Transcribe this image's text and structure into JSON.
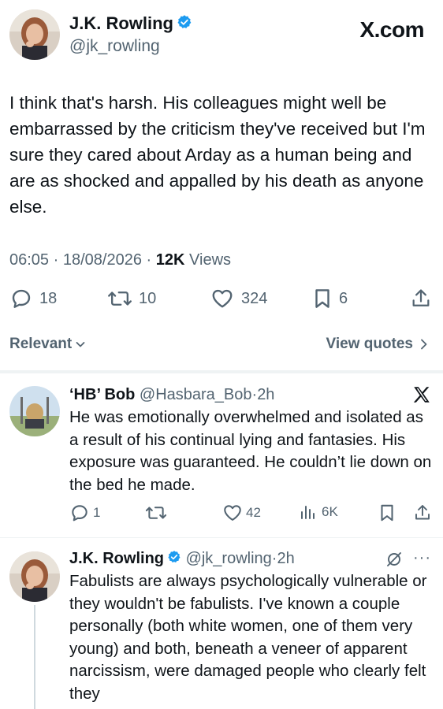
{
  "brand": {
    "domain": "X.com"
  },
  "main_tweet": {
    "author_name": "J.K. Rowling",
    "handle": "@jk_rowling",
    "text": "I think that's harsh. His colleagues might well be embarrassed by the criticism they've received but I'm sure they cared about Arday as a human being and are as shocked and appalled by his death as anyone else.",
    "time": "06:05",
    "date": "18/08/2026",
    "views_count": "12K",
    "views_label": "Views",
    "replies": "18",
    "reposts": "10",
    "likes": "324",
    "bookmarks": "6"
  },
  "sort_bar": {
    "relevant": "Relevant",
    "view_quotes": "View quotes"
  },
  "replies": [
    {
      "author_name": "‘HB’ Bob",
      "handle": "@Hasbara_Bob",
      "time": "2h",
      "text": "He was emotionally overwhelmed and isolated as a result of his continual lying and fantasies. His exposure was guaranteed. He couldn’t lie down on the bed he made.",
      "replies": "1",
      "likes": "42",
      "views": "6K"
    },
    {
      "author_name": "J.K. Rowling",
      "handle": "@jk_rowling",
      "time": "2h",
      "text": "Fabulists are always psychologically vulnerable or they wouldn't be fabulists. I've known a couple personally (both white women, one of them very young) and both, beneath a veneer of apparent narcissism, were damaged people who clearly felt they"
    }
  ],
  "colors": {
    "accent": "#1d9bf0",
    "muted": "#536471",
    "divider": "#eff3f4",
    "text": "#0f1419"
  }
}
